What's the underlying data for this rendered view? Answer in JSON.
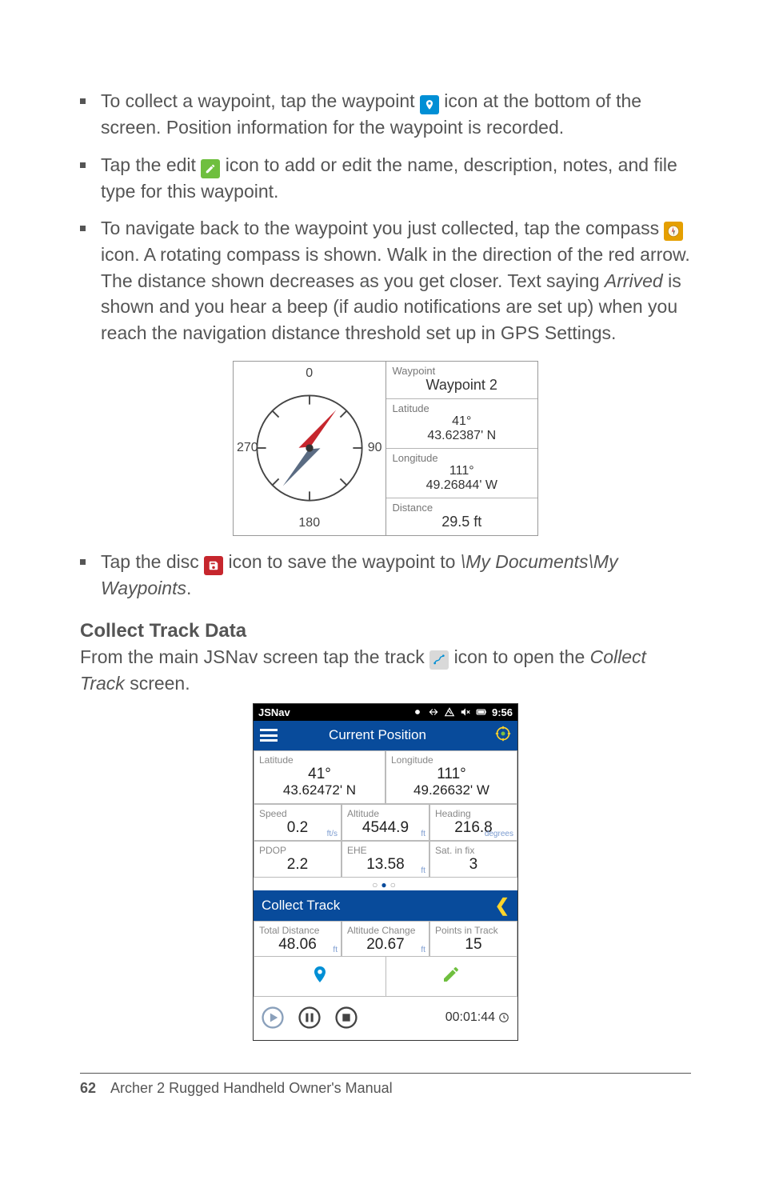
{
  "bullets": {
    "b1a": "To collect a waypoint, tap the waypoint ",
    "b1b": " icon at the bottom of the screen. Position information for the waypoint is recorded.",
    "b2a": "Tap the edit ",
    "b2b": " icon to add or edit the name, description, notes, and file type for this waypoint.",
    "b3a": "To navigate back to the waypoint you just collected, tap the compass ",
    "b3b": " icon. A rotating compass is shown. Walk in the direction of the red arrow. The distance shown decreases as you get closer. Text saying ",
    "b3c": "Arrived",
    "b3d": " is shown and you hear a beep (if audio notifications are set up) when you reach the navigation distance threshold set up in GPS Settings.",
    "b4a": "Tap the disc ",
    "b4b": " icon to save the waypoint to ",
    "b4c": "\\My Documents\\My Waypoints",
    "b4d": "."
  },
  "shot1": {
    "compass": {
      "n": "0",
      "s": "180",
      "e": "90",
      "w": "270"
    },
    "waypoint_lbl": "Waypoint",
    "waypoint_val": "Waypoint 2",
    "lat_lbl": "Latitude",
    "lat_deg": "41°",
    "lat_val": "43.62387' N",
    "lon_lbl": "Longitude",
    "lon_deg": "111°",
    "lon_val": "49.26844' W",
    "dist_lbl": "Distance",
    "dist_val": "29.5 ft"
  },
  "section": {
    "title": "Collect Track Data",
    "text_a": "From the main JSNav screen tap the track ",
    "text_b": " icon to open the ",
    "text_c": "Collect Track",
    "text_d": " screen."
  },
  "shot2": {
    "status_app": "JSNav",
    "status_time": "9:56",
    "bluebar_title": "Current Position",
    "lat_lbl": "Latitude",
    "lat_deg": "41°",
    "lat_val": "43.62472' N",
    "lon_lbl": "Longitude",
    "lon_deg": "111°",
    "lon_val": "49.26632' W",
    "speed_lbl": "Speed",
    "speed_val": "0.2",
    "speed_unit": "ft/s",
    "alt_lbl": "Altitude",
    "alt_val": "4544.9",
    "alt_unit": "ft",
    "head_lbl": "Heading",
    "head_val": "216.8",
    "head_unit": "degrees",
    "pdop_lbl": "PDOP",
    "pdop_val": "2.2",
    "ehe_lbl": "EHE",
    "ehe_val": "13.58",
    "ehe_unit": "ft",
    "sat_lbl": "Sat. in fix",
    "sat_val": "3",
    "collect_title": "Collect Track",
    "td_lbl": "Total Distance",
    "td_val": "48.06",
    "td_unit": "ft",
    "ac_lbl": "Altitude Change",
    "ac_val": "20.67",
    "ac_unit": "ft",
    "pit_lbl": "Points in Track",
    "pit_val": "15",
    "timer": "00:01:44"
  },
  "footer": {
    "page": "62",
    "title": "Archer 2 Rugged Handheld Owner's Manual"
  }
}
